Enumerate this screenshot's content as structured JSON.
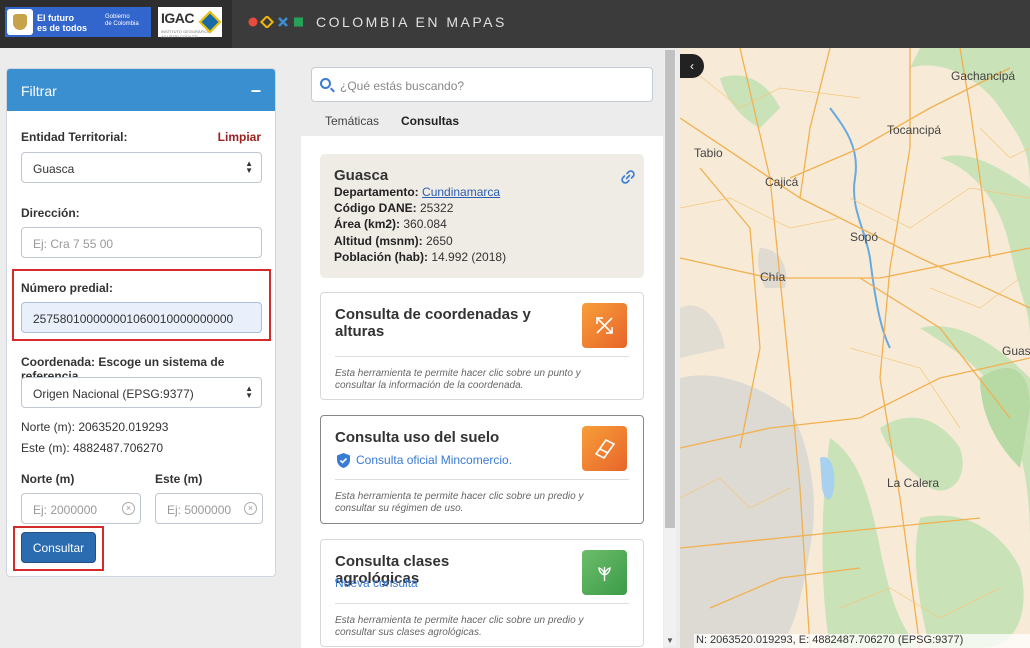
{
  "header": {
    "gov_line1": "El futuro",
    "gov_line2": "es de todos",
    "gov_sub1": "Gobierno",
    "gov_sub2": "de Colombia",
    "igac": "IGAC",
    "igac_sub": "INSTITUTO GEOGRÁFICO AGUSTÍN CODAZZI",
    "title": "COLOMBIA EN MAPAS",
    "brand_colors": [
      "#e94b3c",
      "#f2b705",
      "#3a8fd1",
      "#27a05a"
    ]
  },
  "filter": {
    "title": "Filtrar",
    "collapse": "–",
    "entity_label": "Entidad Territorial:",
    "clear_label": "Limpiar",
    "entity_value": "Guasca",
    "address_label": "Dirección:",
    "address_placeholder": "Ej: Cra 7 55 00",
    "parcel_label": "Número predial:",
    "parcel_value": "257580100000001060010000000000",
    "coord_label": "Coordenada: Escoge un sistema de referencia",
    "crs_value": "Origen Nacional (EPSG:9377)",
    "norte_text": "Norte (m): 2063520.019293",
    "este_text": "Este (m): 4882487.706270",
    "norte_label": "Norte (m)",
    "este_label": "Este (m)",
    "norte_placeholder": "Ej: 2000000",
    "este_placeholder": "Ej: 5000000",
    "submit": "Consultar",
    "highlight_color": "#d42a2a"
  },
  "search": {
    "placeholder": "¿Qué estás buscando?"
  },
  "tabs": [
    {
      "label": "Temáticas",
      "active": false
    },
    {
      "label": "Consultas",
      "active": true
    }
  ],
  "info": {
    "name": "Guasca",
    "dept_label": "Departamento:",
    "dept_value": "Cundinamarca",
    "dane_label": "Código DANE:",
    "dane_value": "25322",
    "area_label": "Área (km2):",
    "area_value": "360.084",
    "alt_label": "Altitud (msnm):",
    "alt_value": "2650",
    "pop_label": "Población (hab):",
    "pop_value": "14.992 (2018)"
  },
  "cards": [
    {
      "title": "Consulta de coordenadas y alturas",
      "desc": "Esta herramienta te permite hacer clic sobre un punto y consultar la información de la coordenada.",
      "icon": "arrows-icon"
    },
    {
      "title": "Consulta uso del suelo",
      "sub": "Consulta oficial Mincomercio.",
      "desc": "Esta herramienta te permite hacer clic sobre un predio y consultar su régimen de uso.",
      "icon": "eraser-icon"
    },
    {
      "title": "Consulta clases agrológicas",
      "sub": "Nueva consulta",
      "desc": "Esta herramienta te permite hacer clic sobre un predio y consultar sus clases agrológicas.",
      "icon": "plant-icon"
    }
  ],
  "map": {
    "collapse": "‹",
    "places": [
      "Gachancipá",
      "Tocancipá",
      "Tabio",
      "Cajicá",
      "Sopó",
      "Chía",
      "Guasca",
      "La Calera"
    ],
    "coords": "N: 2063520.019293, E: 4882487.706270 (EPSG:9377)"
  }
}
